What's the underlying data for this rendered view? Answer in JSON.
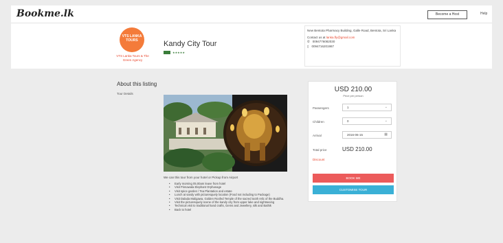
{
  "topbar": {
    "logo": "Bookme.lk",
    "host_label": "Become a Host",
    "help_label": "Help"
  },
  "agency": {
    "logo_text": "VTS LANKA TOURS",
    "name": "VTS Lanka Tours & The Green Agency"
  },
  "tour": {
    "title": "Kandy City Tour",
    "rating_text": "★★★★★"
  },
  "contact": {
    "address": "New Bentota Pharmacy Building, Galle Road, Bentota, Sri Lanka",
    "email_prefix": "Contact us at",
    "email": "lanka.fly@gmail.com",
    "phone1": "0094776082030",
    "phone2": "0094716201987"
  },
  "listing": {
    "about_title": "About this listing",
    "tour_details_label": "Tour Details",
    "description": "We can this tour from your hotel or Pickup from Airport",
    "highlights": [
      "Early morning 05.00am leave from hotel",
      "Visit Pinnawala Elephant Orphanage",
      "Visit spice garden / Tea Plantation and estate",
      "Lunch at sandy with picturesquely location (Food not including to Package)",
      "Visit Dalada Maligawa, Golden Roofed Temple of the sacred tooth relic of the Buddha.",
      "Visit the picturesquely scene of the kandy city from upper lake and sightseeing",
      "Technical visit to traditional hand crafts, Gems and Jewellery, silk and Bathik",
      "Back to hotel"
    ]
  },
  "booking": {
    "price": "USD 210.00",
    "price_sub": "Price per person",
    "passengers_label": "Passengers",
    "passengers_value": "1",
    "children_label": "Children",
    "children_value": "0",
    "arrival_label": "Arrival",
    "arrival_value": "2016-06-15",
    "total_label": "Total price",
    "total_value": "USD 210.00",
    "discount_label": "Discount",
    "book_label": "BOOK ME",
    "customise_label": "CUSTOMISE TOUR"
  },
  "colors": {
    "brand_orange": "#f47b3a",
    "book_red": "#ec5b5b",
    "customise_blue": "#3ab0d6",
    "link_red": "#e8452c"
  }
}
